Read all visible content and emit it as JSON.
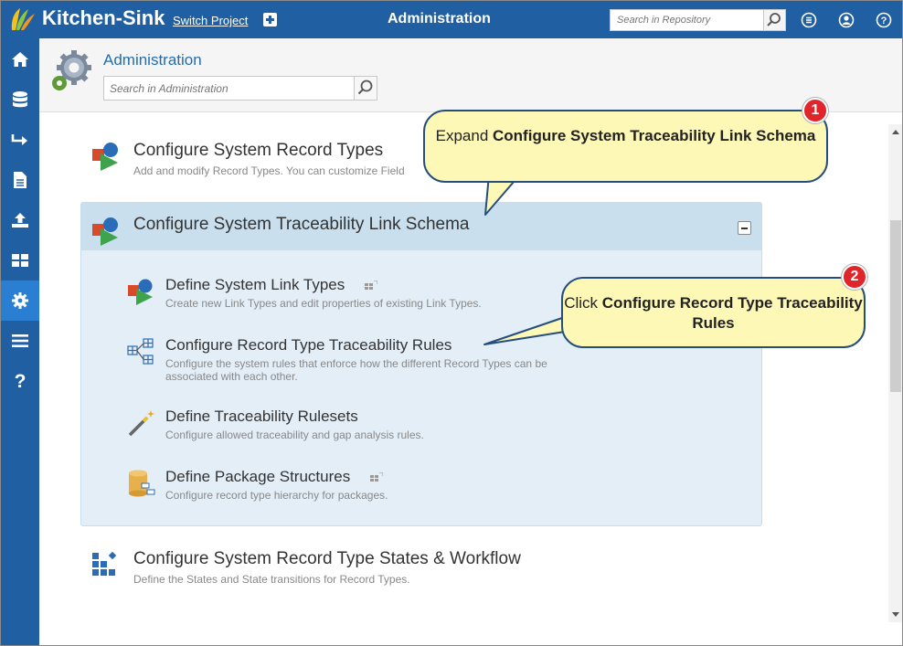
{
  "topbar": {
    "app_name": "Kitchen-Sink",
    "switch_project": "Switch Project",
    "section_title": "Administration",
    "search_placeholder": "Search in Repository",
    "icons": [
      "plus-icon",
      "search-icon",
      "list-icon",
      "user-icon",
      "help-icon"
    ]
  },
  "sidebar": {
    "items": [
      {
        "icon": "home-icon"
      },
      {
        "icon": "database-icon"
      },
      {
        "icon": "arrow-icon"
      },
      {
        "icon": "document-icon"
      },
      {
        "icon": "upload-icon"
      },
      {
        "icon": "dashboard-icon"
      },
      {
        "icon": "gear-icon",
        "active": true
      },
      {
        "icon": "menu-icon"
      },
      {
        "icon": "question-icon"
      }
    ]
  },
  "header": {
    "title": "Administration",
    "search_placeholder": "Search in Administration"
  },
  "sections": {
    "record_types": {
      "title": "Configure System Record Types",
      "description": "Add and modify Record Types. You can customize Field"
    },
    "traceability": {
      "title": "Configure System Traceability Link Schema",
      "items": [
        {
          "title": "Define System Link Types",
          "description": "Create new Link Types and edit properties of existing Link Types."
        },
        {
          "title": "Configure Record Type Traceability Rules",
          "description": "Configure the system rules that enforce how the different Record Types can be associated with each other."
        },
        {
          "title": "Define Traceability Rulesets",
          "description": "Configure allowed traceability and gap analysis rules."
        },
        {
          "title": "Define Package Structures",
          "description": "Configure record type hierarchy for packages."
        }
      ]
    },
    "workflow": {
      "title": "Configure System Record Type States & Workflow",
      "description": "Define the States and State transitions for Record Types."
    }
  },
  "callouts": [
    {
      "badge": "1",
      "prefix": "Expand ",
      "bold": "Configure System Traceability Link Schema"
    },
    {
      "badge": "2",
      "prefix": "Click ",
      "bold": "Configure Record Type Traceability Rules"
    }
  ],
  "colors": {
    "brand_blue": "#1f5fa2",
    "active_nav": "#2b7fd3",
    "panel_bg": "#e3eef7",
    "callout_fill": "#fdf8b6",
    "badge_red": "#e0262b"
  }
}
